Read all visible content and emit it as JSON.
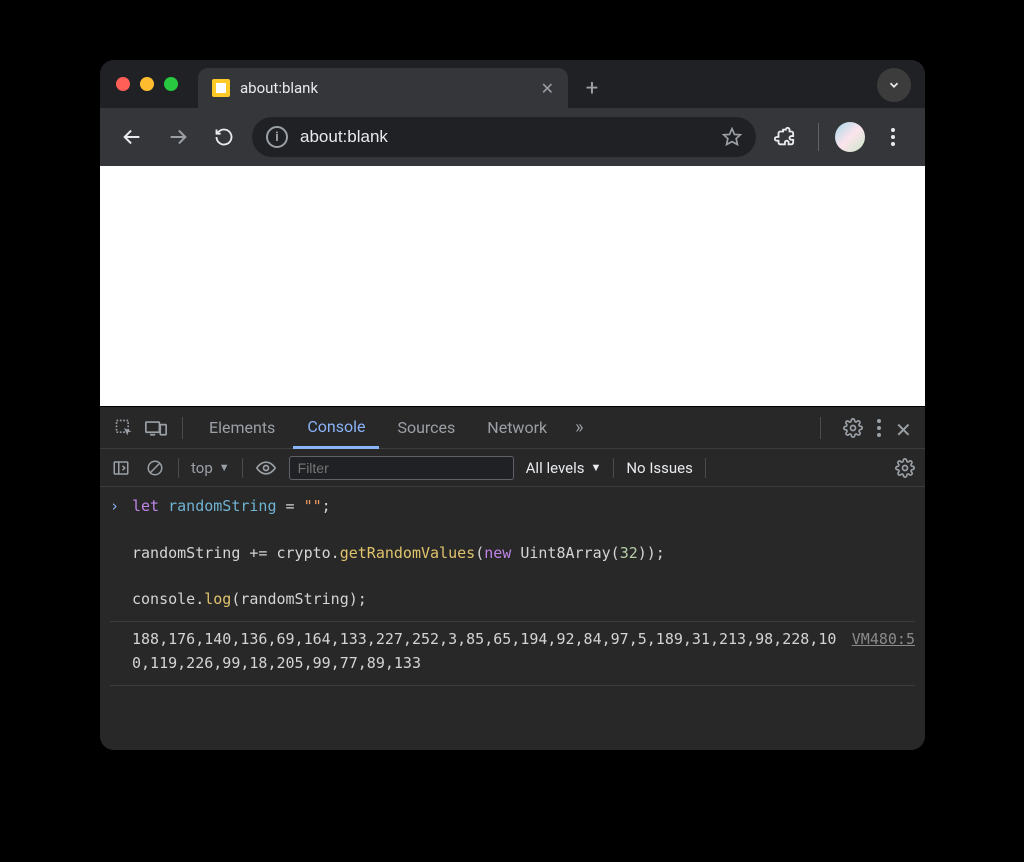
{
  "tab": {
    "title": "about:blank"
  },
  "toolbar": {
    "url": "about:blank"
  },
  "devtools": {
    "tabs": {
      "elements": "Elements",
      "console": "Console",
      "sources": "Sources",
      "network": "Network"
    },
    "console_toolbar": {
      "context": "top",
      "filter_placeholder": "Filter",
      "levels": "All levels",
      "issues": "No Issues"
    },
    "console": {
      "input": {
        "line1_let": "let",
        "line1_var": " randomString ",
        "line1_eq": "= ",
        "line1_str": "\"\"",
        "line1_semi": ";",
        "line2_a": "randomString ",
        "line2_b": "+= ",
        "line2_c": "crypto.",
        "line2_d": "getRandomValues",
        "line2_e": "(",
        "line2_f": "new",
        "line2_g": " Uint8Array(",
        "line2_h": "32",
        "line2_i": "));",
        "line3_a": "console.",
        "line3_b": "log",
        "line3_c": "(randomString);"
      },
      "output": "188,176,140,136,69,164,133,227,252,3,85,65,194,92,84,97,5,189,31,213,98,228,100,119,226,99,18,205,99,77,89,133",
      "source": "VM480:5"
    }
  }
}
